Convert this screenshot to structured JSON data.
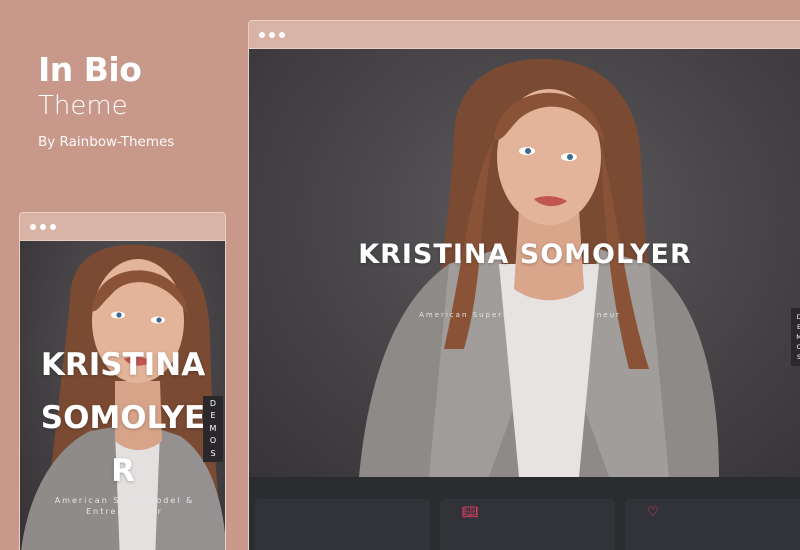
{
  "brand": {
    "title": "In Bio",
    "subtitle": "Theme",
    "byline": "By Rainbow-Themes"
  },
  "desktop_preview": {
    "name": "KRISTINA SOMOLYER",
    "tagline": "American Supermodel & Entrepreneur",
    "demos_letters": [
      "D",
      "E",
      "M",
      "O",
      "S"
    ],
    "card_icons": [
      "book-icon",
      "heart-icon"
    ]
  },
  "mobile_preview": {
    "name_lines": [
      "KRISTINA",
      "SOMOLYE",
      "R"
    ],
    "tagline_lines": [
      "American Supermodel &",
      "Entrepreneur"
    ],
    "demos_letters": [
      "D",
      "E",
      "M",
      "O",
      "S"
    ]
  },
  "colors": {
    "background": "#c8998a",
    "window_bar": "#d9b4a6",
    "hero_dark": "#4a474b",
    "lower_section": "#2b2c30",
    "accent": "#ff3c6e"
  }
}
